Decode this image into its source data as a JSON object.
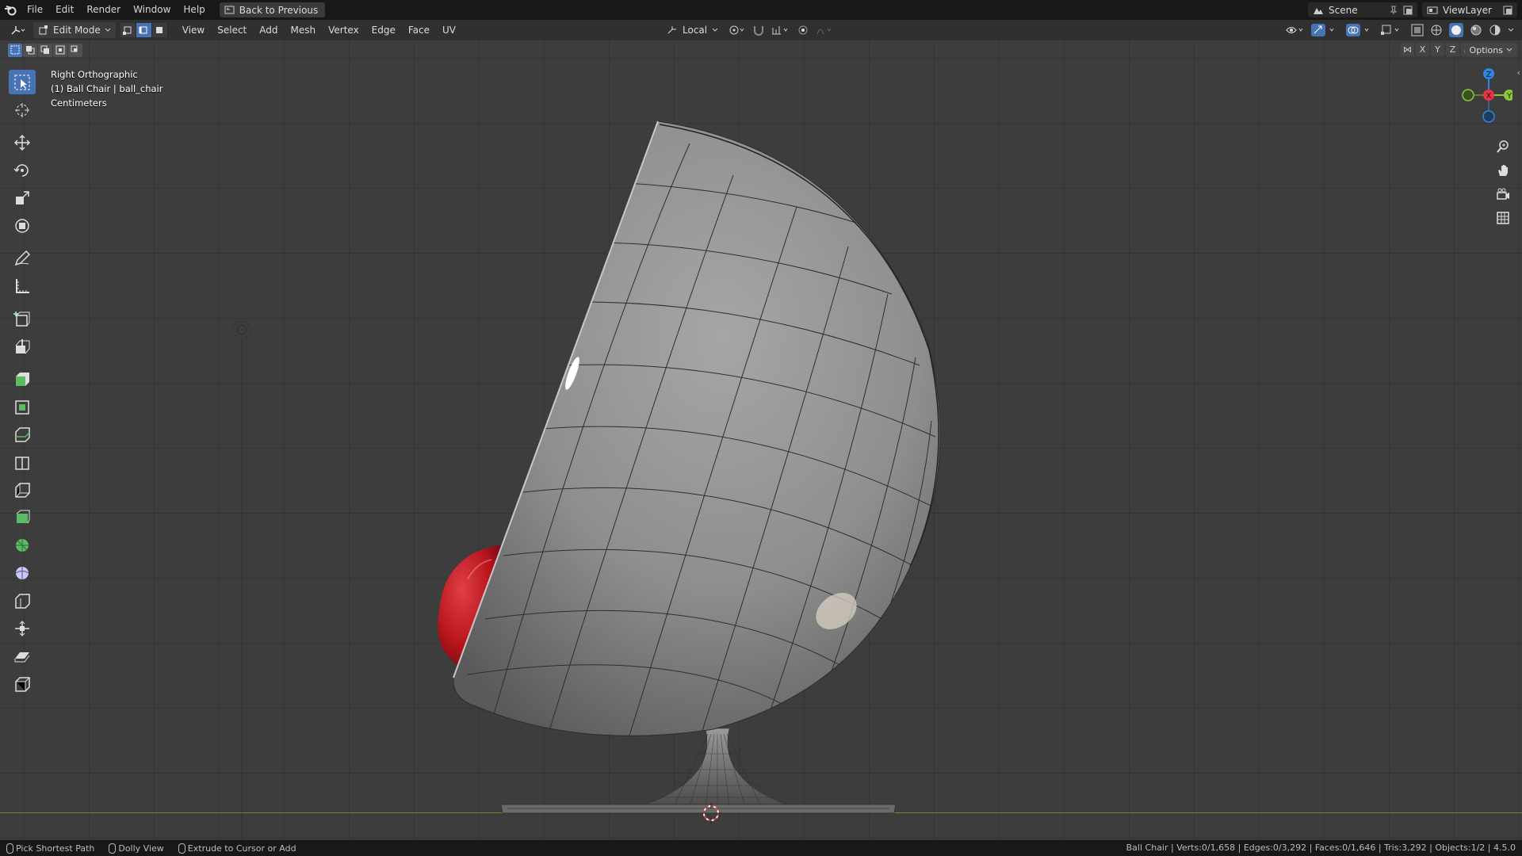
{
  "menu": {
    "items": [
      "File",
      "Edit",
      "Render",
      "Window",
      "Help"
    ],
    "back_button": "Back to Previous"
  },
  "top_right": {
    "scene": "Scene",
    "view_layer": "ViewLayer"
  },
  "header": {
    "mode": "Edit Mode",
    "menus": [
      "View",
      "Select",
      "Add",
      "Mesh",
      "Vertex",
      "Edge",
      "Face",
      "UV"
    ],
    "orientation": "Local"
  },
  "viewport": {
    "view_name": "Right Orthographic",
    "object_info": "(1) Ball Chair | ball_chair",
    "units": "Centimeters",
    "axis_x": "X",
    "axis_y": "Y",
    "axis_z": "Z",
    "options_label": "Options"
  },
  "gizmo": {
    "z": "Z",
    "x": "X",
    "y": "Y"
  },
  "status": {
    "hint1": "Pick Shortest Path",
    "hint2": "Dolly View",
    "hint3": "Extrude to Cursor or Add",
    "stats": "Ball Chair | Verts:0/1,658 | Edges:0/3,292 | Faces:0/1,646 | Tris:3,292 | Objects:1/2 | 4.5.0"
  },
  "colors": {
    "accent": "#4772b3",
    "viewport_bg": "#3d3d3d",
    "cushion": "#c0151d",
    "axis_x": "#e8334a",
    "axis_y": "#8cc63f",
    "axis_z": "#2e86de"
  }
}
